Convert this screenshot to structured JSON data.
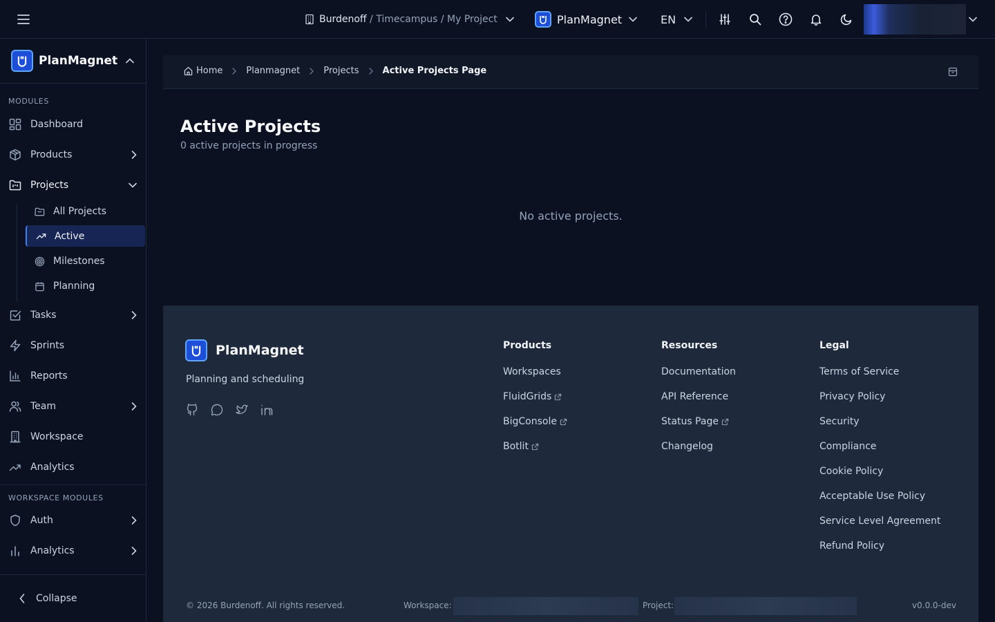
{
  "topbar": {
    "context_org": "Burdenoff",
    "context_path": " / Timecampus / My Project",
    "app_name": "PlanMagnet",
    "language": "EN"
  },
  "sidebar": {
    "brand": "PlanMagnet",
    "section_modules": "MODULES",
    "items": {
      "dashboard": "Dashboard",
      "products": "Products",
      "projects": "Projects",
      "tasks": "Tasks",
      "sprints": "Sprints",
      "reports": "Reports",
      "team": "Team",
      "workspace": "Workspace",
      "analytics": "Analytics"
    },
    "projects_sub": {
      "all": "All Projects",
      "active": "Active",
      "milestones": "Milestones",
      "planning": "Planning"
    },
    "section_workspace": "WORKSPACE MODULES",
    "workspace_items": {
      "auth": "Auth",
      "analytics": "Analytics"
    },
    "collapse": "Collapse"
  },
  "breadcrumb": {
    "home": "Home",
    "planmagnet": "Planmagnet",
    "projects": "Projects",
    "current": "Active Projects Page"
  },
  "main": {
    "title": "Active Projects",
    "subtitle": "0 active projects in progress",
    "empty": "No active projects."
  },
  "footer": {
    "brand": "PlanMagnet",
    "tagline": "Planning and scheduling",
    "products": {
      "title": "Products",
      "links": [
        "Workspaces",
        "FluidGrids",
        "BigConsole",
        "Botlit"
      ]
    },
    "resources": {
      "title": "Resources",
      "links": [
        "Documentation",
        "API Reference",
        "Status Page",
        "Changelog"
      ]
    },
    "legal": {
      "title": "Legal",
      "links": [
        "Terms of Service",
        "Privacy Policy",
        "Security",
        "Compliance",
        "Cookie Policy",
        "Acceptable Use Policy",
        "Service Level Agreement",
        "Refund Policy"
      ]
    },
    "copyright": "© 2026 Burdenoff. All rights reserved.",
    "workspace_label": "Workspace:",
    "project_label": "Project:",
    "version": "v0.0.0-dev"
  },
  "colors": {
    "background": "#0b1120",
    "panel": "#111827",
    "footer": "#1e293b",
    "accent": "#3b82f6",
    "active_bg": "#172554"
  }
}
